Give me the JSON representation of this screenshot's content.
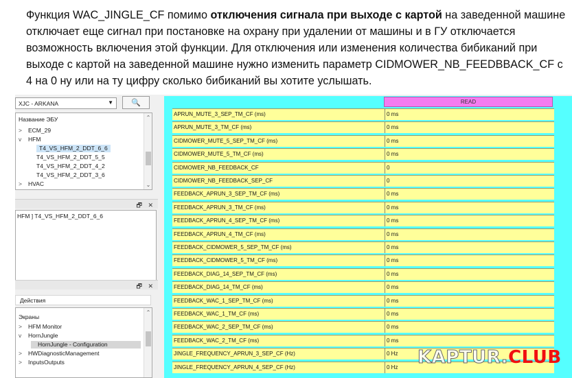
{
  "article": {
    "p1": "Функция WAC_JINGLE_CF помимо ",
    "p_bold": "отключения сигнала при выходе с картой",
    "p2": " на заведенной машине отключает еще сигнал при постановке на охрану при удалении от машины и в ГУ отключается возможность включения этой функции. Для отключения или изменения количества бибиканий при выходе с картой на заведенной машине нужно изменить параметр CIDMOWER_NB_FEEDBBACK_CF с 4 на 0 ну или на ту цифру сколько бибиканий вы хотите услышать."
  },
  "left": {
    "ecu_select": "XJC - ARKANA",
    "tree_header": "Название ЭБУ",
    "tree_items": [
      {
        "chev": ">",
        "label": "ECM_29"
      },
      {
        "chev": "v",
        "label": "HFM"
      },
      {
        "chev": "",
        "label": "T4_VS_HFM_2_DDT_6_6"
      },
      {
        "chev": "",
        "label": "T4_VS_HFM_2_DDT_5_5"
      },
      {
        "chev": "",
        "label": "T4_VS_HFM_2_DDT_4_2"
      },
      {
        "chev": "",
        "label": "T4_VS_HFM_2_DDT_3_6"
      },
      {
        "chev": ">",
        "label": "HVAC"
      }
    ],
    "path_text": "HFM ] T4_VS_HFM_2_DDT_6_6",
    "actions_label": "Действия",
    "screens_label": "Экраны",
    "screens": [
      {
        "chev": ">",
        "label": "HFM Monitor"
      },
      {
        "chev": "v",
        "label": "HornJungle"
      },
      {
        "chev": "",
        "label": "HornJungle - Configuration"
      },
      {
        "chev": ">",
        "label": "HWDiagnosticManagement"
      },
      {
        "chev": ">",
        "label": "InputsOutputs"
      }
    ],
    "panel_buttons": "🗗 ✕"
  },
  "grid": {
    "column_header": "READ",
    "rows": [
      {
        "name": "APRUN_MUTE_3_SEP_TM_CF (ms)",
        "value": "0 ms"
      },
      {
        "name": "APRUN_MUTE_3_TM_CF (ms)",
        "value": "0 ms"
      },
      {
        "name": "CIDMOWER_MUTE_5_SEP_TM_CF (ms)",
        "value": "0 ms"
      },
      {
        "name": "CIDMOWER_MUTE_5_TM_CF (ms)",
        "value": "0 ms"
      },
      {
        "name": "CIDMOWER_NB_FEEDBACK_CF",
        "value": "0"
      },
      {
        "name": "CIDMOWER_NB_FEEDBACK_SEP_CF",
        "value": "0"
      },
      {
        "name": "FEEDBACK_APRUN_3_SEP_TM_CF (ms)",
        "value": "0 ms"
      },
      {
        "name": "FEEDBACK_APRUN_3_TM_CF (ms)",
        "value": "0 ms"
      },
      {
        "name": "FEEDBACK_APRUN_4_SEP_TM_CF (ms)",
        "value": "0 ms"
      },
      {
        "name": "FEEDBACK_APRUN_4_TM_CF (ms)",
        "value": "0 ms"
      },
      {
        "name": "FEEDBACK_CIDMOWER_5_SEP_TM_CF (ms)",
        "value": "0 ms"
      },
      {
        "name": "FEEDBACK_CIDMOWER_5_TM_CF (ms)",
        "value": "0 ms"
      },
      {
        "name": "FEEDBACK_DIAG_14_SEP_TM_CF (ms)",
        "value": "0 ms"
      },
      {
        "name": "FEEDBACK_DIAG_14_TM_CF (ms)",
        "value": "0 ms"
      },
      {
        "name": "FEEDBACK_WAC_1_SEP_TM_CF (ms)",
        "value": "0 ms"
      },
      {
        "name": "FEEDBACK_WAC_1_TM_CF (ms)",
        "value": "0 ms"
      },
      {
        "name": "FEEDBACK_WAC_2_SEP_TM_CF (ms)",
        "value": "0 ms"
      },
      {
        "name": "FEEDBACK_WAC_2_TM_CF (ms)",
        "value": "0 ms"
      },
      {
        "name": "JINGLE_FREQUENCY_APRUN_3_SEP_CF (Hz)",
        "value": "0 Hz"
      },
      {
        "name": "JINGLE_FREQUENCY_APRUN_4_SEP_CF (Hz)",
        "value": "0 Hz"
      }
    ]
  },
  "watermark": {
    "part1": "KAPTUR.",
    "part2": "CLUB"
  },
  "colors": {
    "grid_bg": "#55ffff",
    "cell_bg": "#ffff9a",
    "header_bg": "#f57bf0",
    "watermark_accent": "#f01010"
  }
}
